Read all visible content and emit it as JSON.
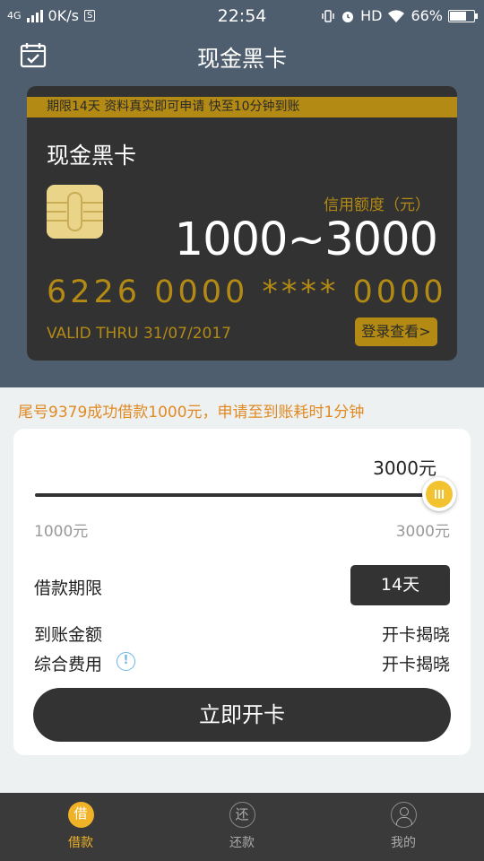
{
  "status_bar": {
    "network": "4G",
    "speed": "0K/s",
    "speed_icon": "S",
    "time": "22:54",
    "hd": "HD",
    "battery": "66%"
  },
  "header": {
    "title": "现金黑卡",
    "calendar_icon": "calendar-check-icon"
  },
  "card": {
    "banner": "期限14天 资料真实即可申请 快至10分钟到账",
    "name": "现金黑卡",
    "credit_label": "信用额度（元）",
    "credit_range": "1000~3000",
    "number": "6226 0000 **** 0000",
    "valid": "VALID THRU 31/07/2017",
    "login_button": "登录查看>"
  },
  "notice": "尾号9379成功借款1000元，申请至到账耗时1分钟",
  "loan": {
    "amount_display": "3000元",
    "slider_min": "1000元",
    "slider_max": "3000元",
    "slider_fraction": 1.0,
    "term_label": "借款期限",
    "term_value": "14天",
    "arrival_label": "到账金额",
    "arrival_value": "开卡揭晓",
    "fee_label": "综合费用",
    "fee_value": "开卡揭晓",
    "cta": "立即开卡"
  },
  "tabs": [
    {
      "icon": "借",
      "label": "借款",
      "active": true
    },
    {
      "icon": "还",
      "label": "还款",
      "active": false
    },
    {
      "icon": "user-icon",
      "label": "我的",
      "active": false
    }
  ],
  "colors": {
    "header_bg": "#4f5e6e",
    "card_bg": "#323232",
    "gold": "#b38a14",
    "notice": "#e08a23",
    "accent": "#f0b327"
  }
}
